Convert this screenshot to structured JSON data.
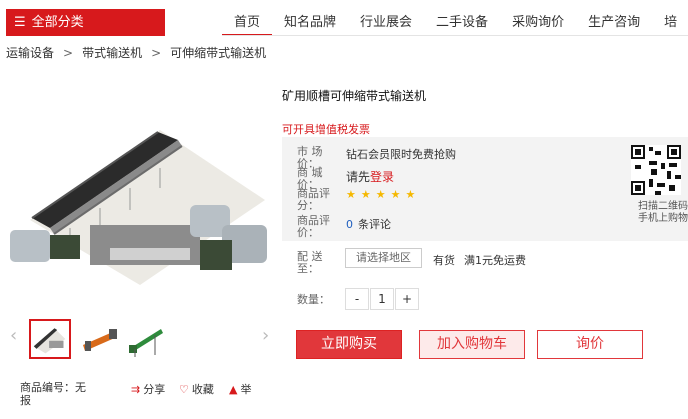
{
  "header": {
    "category_button": "全部分类",
    "nav": [
      "首页",
      "知名品牌",
      "行业展会",
      "二手设备",
      "采购询价",
      "生产咨询",
      "培"
    ]
  },
  "breadcrumb": [
    "运输设备",
    "带式输送机",
    "可伸缩带式输送机"
  ],
  "product": {
    "title": "矿用顺槽可伸缩带式输送机",
    "vat_note": "可开具增值税发票",
    "market_price_label": "市 场 价：",
    "market_price_value": "钻石会员限时免费抢购",
    "mall_price_label": "商 城 价：",
    "mall_price_prefix": "请先",
    "mall_price_login": "登录",
    "rating_label": "商品评分：",
    "rating_stars": "★★★★★",
    "review_label": "商品评价：",
    "review_count": "0",
    "review_unit": "条评论",
    "qr_label": "扫描二维码手机上购物",
    "delivery_label": "配 送 至：",
    "region_placeholder": "请选择地区",
    "stock": "有货",
    "shipping": "满1元免运费",
    "quantity_label": "数量：",
    "quantity_minus": "-",
    "quantity_value": "1",
    "quantity_plus": "+",
    "buy_now": "立即购买",
    "add_cart": "加入购物车",
    "inquiry": "询价"
  },
  "gallery": {
    "prev": "‹",
    "next": "›"
  },
  "meta": {
    "sku_label": "商品编号：无报",
    "share": "分享",
    "favorite": "收藏",
    "report": "举"
  }
}
